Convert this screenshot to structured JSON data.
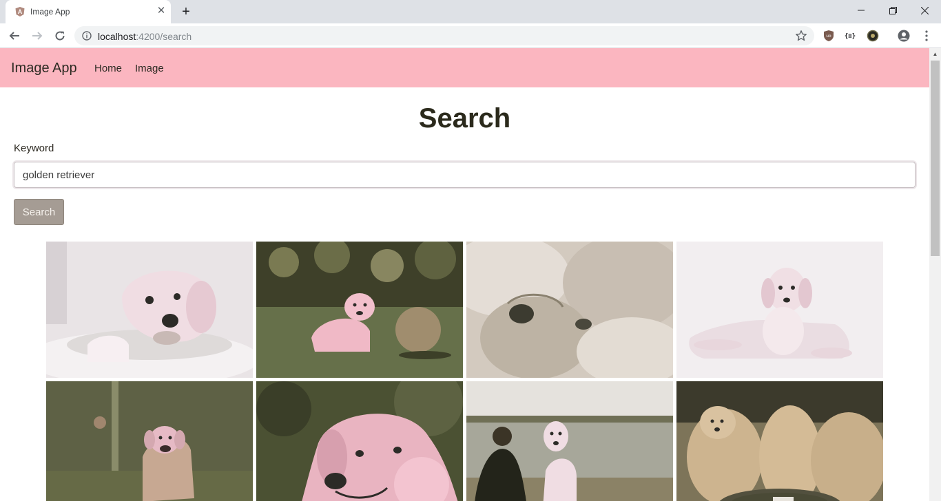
{
  "browser": {
    "tab_title": "Image App",
    "url_host": "localhost",
    "url_rest": ":4200/search"
  },
  "navbar": {
    "brand": "Image App",
    "links": [
      "Home",
      "Image"
    ],
    "bg_color": "#fbb6c0"
  },
  "page": {
    "title": "Search",
    "keyword_label": "Keyword",
    "keyword_value": "golden retriever",
    "search_button": "Search"
  },
  "results": {
    "images": [
      {
        "name": "golden-retriever-on-pillow-image",
        "bg": "#e9e4e6"
      },
      {
        "name": "puppy-with-ball-on-grass-image",
        "bg": "#5a5e3e"
      },
      {
        "name": "sleeping-puppies-closeup-image",
        "bg": "#d3cabf"
      },
      {
        "name": "puppy-lying-white-background-image",
        "bg": "#f2eef0"
      },
      {
        "name": "dog-on-lawn-with-ball-image",
        "bg": "#5b5c3a"
      },
      {
        "name": "golden-retriever-portrait-image",
        "bg": "#4b5133"
      },
      {
        "name": "puppy-with-person-at-beach-image",
        "bg": "#b9b2a8"
      },
      {
        "name": "puppies-eating-from-bowl-image",
        "bg": "#7d7459"
      }
    ]
  }
}
